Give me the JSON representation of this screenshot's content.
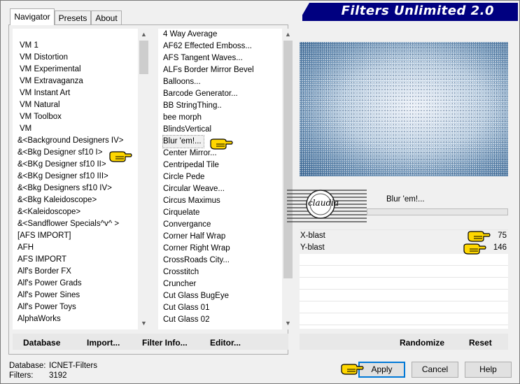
{
  "window": {
    "title": "Filters Unlimited 2.0"
  },
  "tabs": [
    {
      "label": "Navigator",
      "active": true
    },
    {
      "label": "Presets",
      "active": false
    },
    {
      "label": "About",
      "active": false
    }
  ],
  "categories": [
    "VM 1",
    "VM Distortion",
    "VM Experimental",
    "VM Extravaganza",
    "VM Instant Art",
    "VM Natural",
    "VM Toolbox",
    "VM",
    "&<Background Designers IV>",
    "&<Bkg Designer sf10 I>",
    "&<BKg Designer sf10 II>",
    "&<BKg Designer sf10 III>",
    "&<Bkg Designers sf10 IV>",
    "&<Bkg Kaleidoscope>",
    "&<Kaleidoscope>",
    "&<Sandflower Specials^v^ >",
    "[AFS IMPORT]",
    "AFH",
    "AFS IMPORT",
    "Alf's Border FX",
    "Alf's Power Grads",
    "Alf's Power Sines",
    "Alf's Power Toys",
    "AlphaWorks"
  ],
  "filters": [
    "4 Way Average",
    "AF62 Effected Emboss...",
    "AFS Tangent Waves...",
    "ALFs Border Mirror Bevel",
    "Balloons...",
    "Barcode Generator...",
    "BB StringThing..",
    "bee morph",
    "BlindsVertical",
    "Blur 'em!...",
    "Center Mirror...",
    "Centripedal Tile",
    "Circle Pede",
    "Circular Weave...",
    "Circus Maximus",
    "Cirquelate",
    "Convergance",
    "Corner Half Wrap",
    "Corner Right Wrap",
    "CrossRoads City...",
    "Crosstitch",
    "Cruncher",
    "Cut Glass  BugEye",
    "Cut Glass 01",
    "Cut Glass 02"
  ],
  "selected_filter_label": "Blur 'em!...",
  "watermark_text": "claudia",
  "params": [
    {
      "name": "X-blast",
      "value": "75"
    },
    {
      "name": "Y-blast",
      "value": "146"
    }
  ],
  "left_toolbar": {
    "database": "Database",
    "import": "Import...",
    "filter_info": "Filter Info...",
    "editor": "Editor..."
  },
  "right_toolbar": {
    "randomize": "Randomize",
    "reset": "Reset"
  },
  "status": {
    "database_label": "Database:",
    "database_value": "ICNET-Filters",
    "filters_label": "Filters:",
    "filters_value": "3192"
  },
  "buttons": {
    "apply": "Apply",
    "cancel": "Cancel",
    "help": "Help"
  },
  "icons": [
    "pointing-hand-icon",
    "scroll-up-icon",
    "scroll-down-icon"
  ]
}
